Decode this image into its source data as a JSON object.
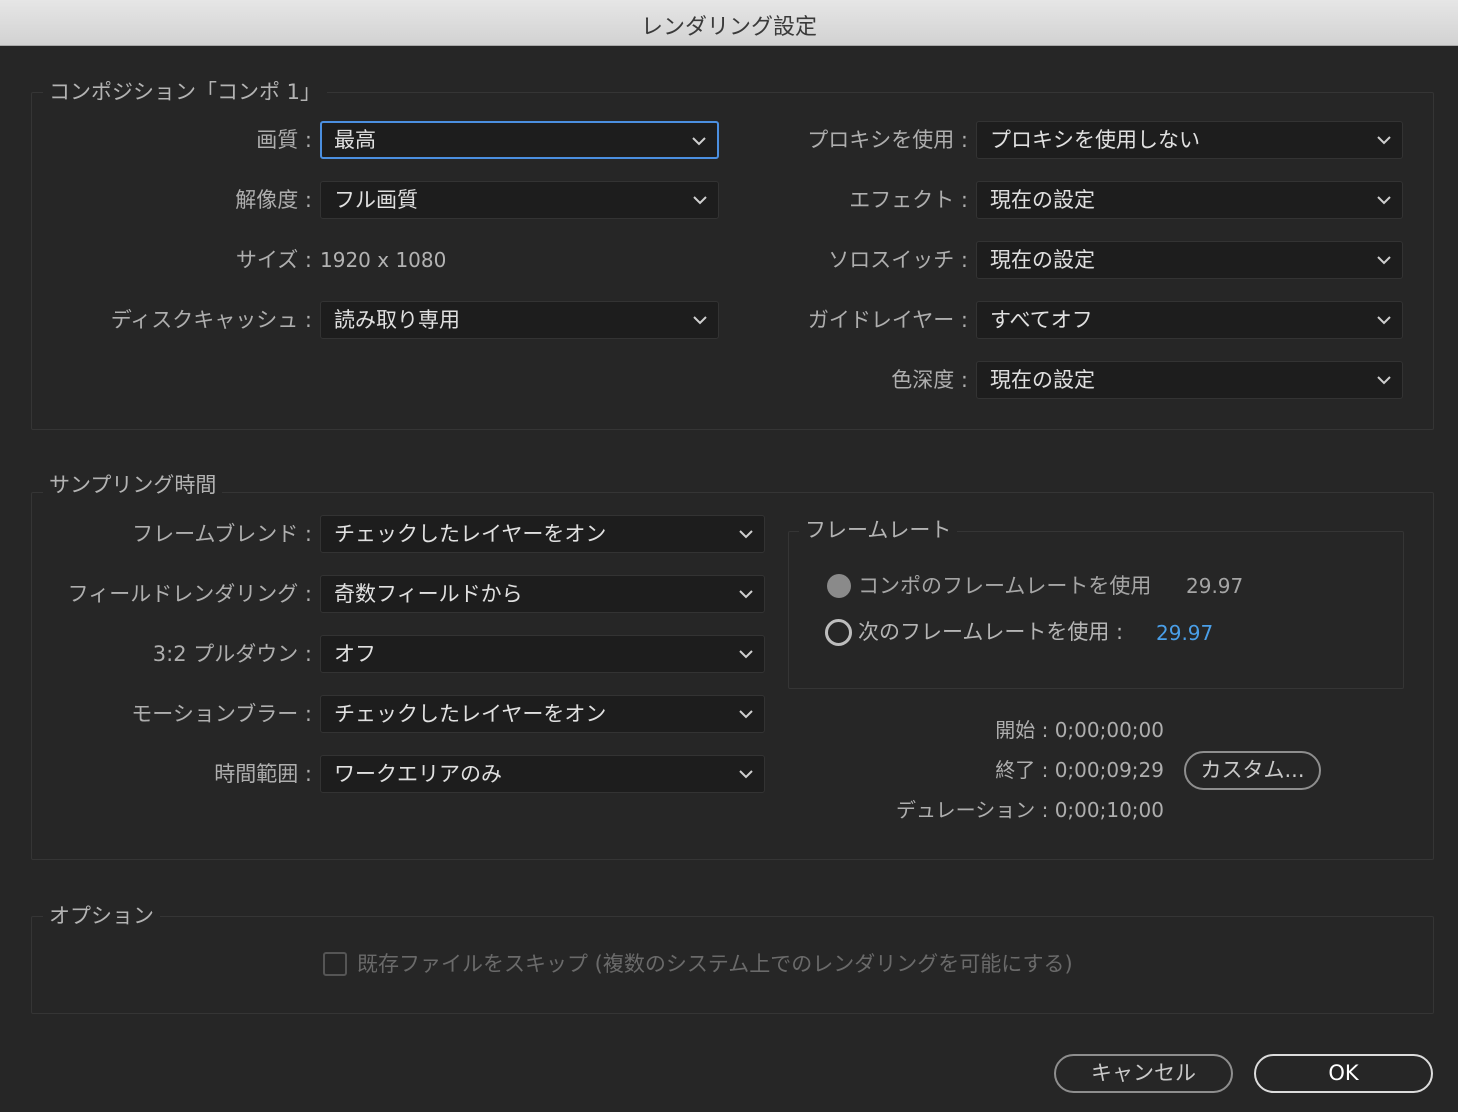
{
  "window": {
    "title": "レンダリング設定"
  },
  "composition": {
    "section_label": "コンポジション「コンポ 1」",
    "quality": {
      "label": "画質 :",
      "value": "最高"
    },
    "resolution": {
      "label": "解像度 :",
      "value": "フル画質"
    },
    "size": {
      "label": "サイズ :",
      "value": "1920 x 1080"
    },
    "disk_cache": {
      "label": "ディスクキャッシュ :",
      "value": "読み取り専用"
    },
    "proxy": {
      "label": "プロキシを使用 :",
      "value": "プロキシを使用しない"
    },
    "effects": {
      "label": "エフェクト :",
      "value": "現在の設定"
    },
    "solo_switch": {
      "label": "ソロスイッチ :",
      "value": "現在の設定"
    },
    "guide_layers": {
      "label": "ガイドレイヤー :",
      "value": "すべてオフ"
    },
    "color_depth": {
      "label": "色深度 :",
      "value": "現在の設定"
    }
  },
  "sampling": {
    "section_label": "サンプリング時間",
    "frame_blend": {
      "label": "フレームブレンド :",
      "value": "チェックしたレイヤーをオン"
    },
    "field_render": {
      "label": "フィールドレンダリング :",
      "value": "奇数フィールドから"
    },
    "pulldown": {
      "label": "3:2 プルダウン :",
      "value": "オフ"
    },
    "motion_blur": {
      "label": "モーションブラー :",
      "value": "チェックしたレイヤーをオン"
    },
    "time_span": {
      "label": "時間範囲 :",
      "value": "ワークエリアのみ"
    },
    "frame_rate": {
      "section_label": "フレームレート",
      "use_comp": {
        "label": "コンポのフレームレートを使用",
        "value": "29.97",
        "selected": false
      },
      "use_this": {
        "label": "次のフレームレートを使用 :",
        "value": "29.97",
        "selected": true
      }
    },
    "start": "開始 : 0;00;00;00",
    "end": "終了 : 0;00;09;29",
    "duration": "デュレーション : 0;00;10;00",
    "custom_button": "カスタム..."
  },
  "options": {
    "section_label": "オプション",
    "skip_existing": {
      "label": "既存ファイルをスキップ (複数のシステム上でのレンダリングを可能にする)",
      "checked": false
    }
  },
  "buttons": {
    "cancel": "キャンセル",
    "ok": "OK"
  },
  "colors": {
    "accent": "#4b8fe0",
    "link_value": "#4a9fe8"
  }
}
